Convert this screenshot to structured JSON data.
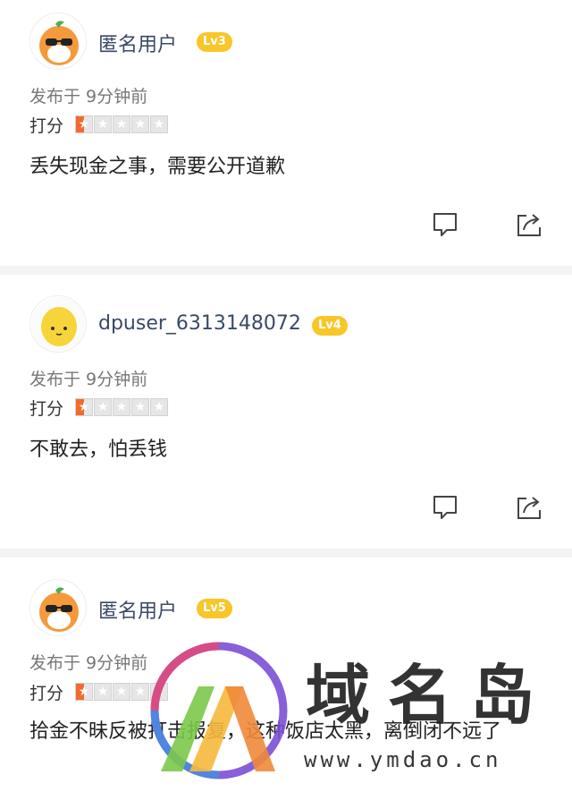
{
  "reviews": [
    {
      "username": "匿名用户",
      "level": "Lv3",
      "posted": "发布于 9分钟前",
      "score_label": "打分",
      "rating": 0.5,
      "content": "丢失现金之事，需要公开道歉",
      "avatar": "orange-sunglasses-icon"
    },
    {
      "username": "dpuser_6313148072",
      "level": "Lv4",
      "posted": "发布于 9分钟前",
      "score_label": "打分",
      "rating": 0.5,
      "content": "不敢去，怕丢钱",
      "avatar": "lemon-icon"
    },
    {
      "username": "匿名用户",
      "level": "Lv5",
      "posted": "发布于 9分钟前",
      "score_label": "打分",
      "rating": 0.5,
      "content": "拾金不昧反被打击报复，这种饭店太黑，离倒闭不远了",
      "avatar": "orange-sunglasses-icon"
    }
  ],
  "watermark": {
    "title": "域名岛",
    "url": "www.ymdao.cn"
  },
  "colors": {
    "level_badge": "#f8c629",
    "star_active": "#f36b2a",
    "divider": "#f3f3f3"
  },
  "icons": [
    "comment-icon",
    "share-icon"
  ]
}
